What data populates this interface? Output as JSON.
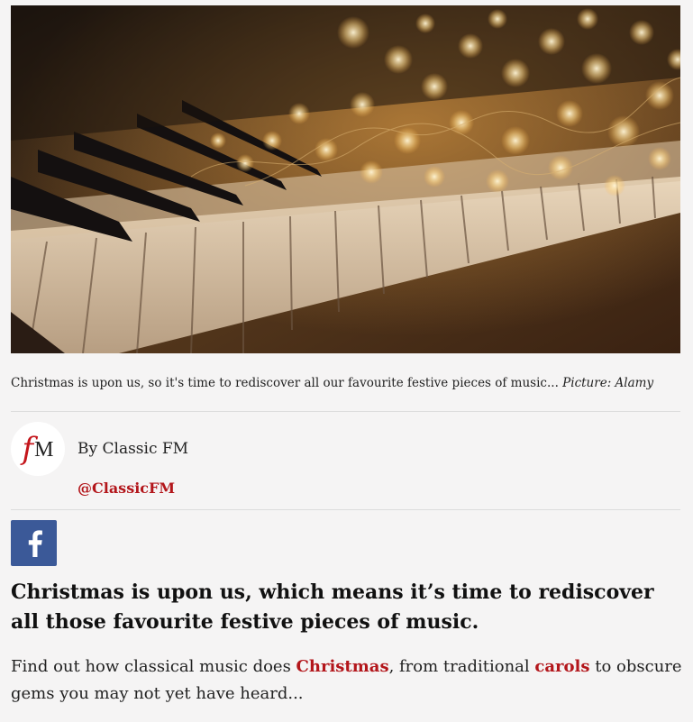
{
  "hero_image": {
    "subject": "piano-keys-with-fairy-lights-photo"
  },
  "caption": {
    "text": "Christmas is upon us, so it's time to rediscover all our favourite festive pieces of music...",
    "credit": "Picture: Alamy"
  },
  "author": {
    "logo_f": "f",
    "logo_m": "M",
    "byline": "By Classic FM",
    "handle": "@ClassicFM"
  },
  "share": {
    "icon": "facebook-icon",
    "color": "#3b5998"
  },
  "article": {
    "lede": "Christmas is upon us, which means it’s time to rediscover all those favourite festive pieces of music.",
    "body_1": "Find out how classical music does ",
    "link_1": "Christmas",
    "body_2": ", from traditional ",
    "link_2": "carols",
    "body_3": " to obscure gems you may not yet have heard..."
  },
  "colors": {
    "link": "#b3161b",
    "background": "#f5f4f4",
    "logo_red": "#c4161c"
  }
}
